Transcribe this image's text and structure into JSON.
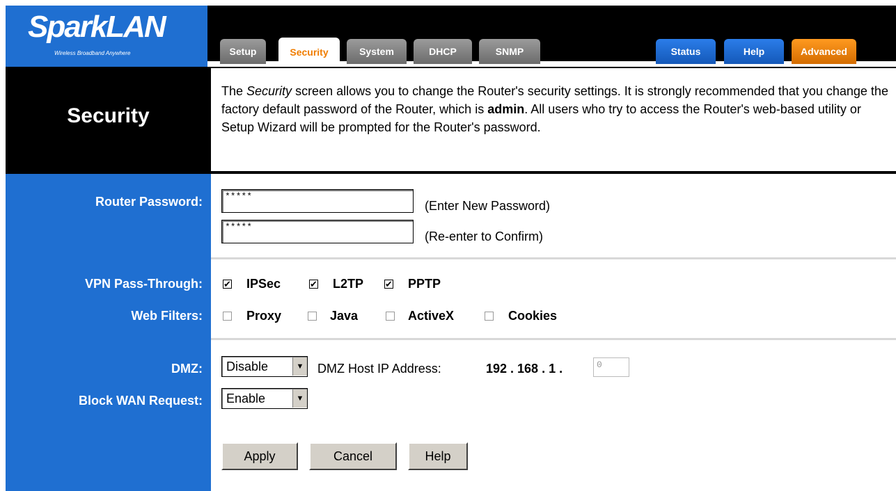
{
  "brand": {
    "name": "SparkLAN",
    "tagline": "Wireless Broadband Anywhere"
  },
  "tabs": [
    {
      "label": "Setup"
    },
    {
      "label": "Security"
    },
    {
      "label": "System"
    },
    {
      "label": "DHCP"
    },
    {
      "label": "SNMP"
    }
  ],
  "right_tabs": [
    {
      "label": "Status"
    },
    {
      "label": "Help"
    },
    {
      "label": "Advanced"
    }
  ],
  "page": {
    "title": "Security",
    "description_part1": "The ",
    "description_em": "Security",
    "description_part2": " screen allows you to change the Router's security settings. It is strongly recommended that you change the factory default password of the Router, which is ",
    "description_bold": "admin",
    "description_part3": ". All users who try to access the Router's web-based utility or Setup Wizard will be prompted for the Router's password."
  },
  "password": {
    "label": "Router Password:",
    "value1": "*****",
    "hint1": "(Enter New Password)",
    "value2": "*****",
    "hint2": "(Re-enter to Confirm)"
  },
  "vpn": {
    "label": "VPN Pass-Through:",
    "options": [
      {
        "label": "IPSec",
        "checked": true
      },
      {
        "label": "L2TP",
        "checked": true
      },
      {
        "label": "PPTP",
        "checked": true
      }
    ]
  },
  "web_filters": {
    "label": "Web Filters:",
    "options": [
      {
        "label": "Proxy",
        "checked": false
      },
      {
        "label": "Java",
        "checked": false
      },
      {
        "label": "ActiveX",
        "checked": false
      },
      {
        "label": "Cookies",
        "checked": false
      }
    ]
  },
  "dmz": {
    "label": "DMZ:",
    "selected": "Disable",
    "host_label": "DMZ Host IP Address:",
    "ip_prefix": "192 . 168 . 1 .",
    "last_octet": "0"
  },
  "block_wan": {
    "label": "Block WAN Request:",
    "selected": "Enable"
  },
  "buttons": {
    "apply": "Apply",
    "cancel": "Cancel",
    "help": "Help"
  },
  "check_mark": "✔",
  "colors": {
    "blue": "#1f6fd1",
    "active_tab_text": "#f07d00",
    "advanced": "#e07800"
  }
}
